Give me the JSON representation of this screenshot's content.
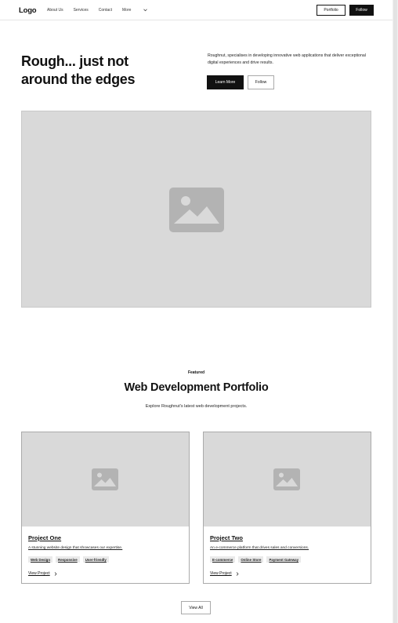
{
  "nav": {
    "logo": "Logo",
    "links": [
      "About Us",
      "Services",
      "Contact"
    ],
    "more_label": "More",
    "portfolio_label": "Portfolio",
    "follow_label": "Follow"
  },
  "hero": {
    "title": "Rough... just not around the edges",
    "description": "Roughnut, specialises in developing innovative web applications that deliver exceptional digital experiences and drive results.",
    "learn_more_label": "Learn More",
    "follow_label": "Follow"
  },
  "portfolio": {
    "tag": "Featured",
    "title": "Web Development Portfolio",
    "subtitle": "Explore Roughnut's latest web development projects.",
    "projects": [
      {
        "title": "Project One",
        "description": "A stunning website design that showcases our expertise.",
        "tags": [
          "Web Design",
          "Responsive",
          "User-friendly"
        ],
        "link_label": "View Project"
      },
      {
        "title": "Project Two",
        "description": "An e-commerce platform that drives sales and conversions.",
        "tags": [
          "E-commerce",
          "Online Store",
          "Payment Gateway"
        ],
        "link_label": "View Project"
      }
    ],
    "view_all_label": "View All"
  }
}
